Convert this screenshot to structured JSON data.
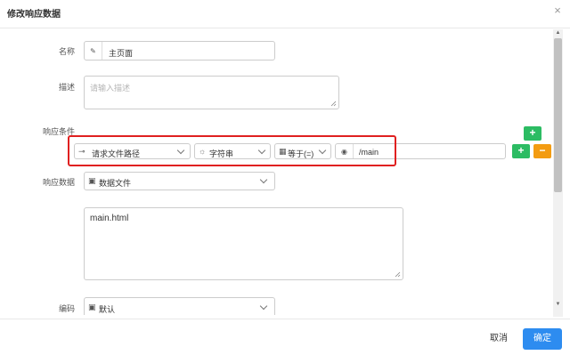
{
  "dialog": {
    "title": "修改响应数据",
    "close_icon": "×"
  },
  "fields": {
    "name": {
      "label": "名称",
      "value": "主页面"
    },
    "desc": {
      "label": "描述",
      "placeholder": "请输入描述"
    },
    "cond": {
      "label": "响应条件",
      "type": "请求文件路径",
      "value_type": "字符串",
      "operator": "等于(=)",
      "value": "/main"
    },
    "resp": {
      "label": "响应数据",
      "type": "数据文件",
      "content": "main.html"
    },
    "encoding": {
      "label": "编码",
      "value": "默认"
    }
  },
  "buttons": {
    "add": "+",
    "remove": "−",
    "cancel": "取消",
    "ok": "确定"
  },
  "scrollbar": {
    "up": "▲",
    "down": "▼"
  },
  "colors": {
    "accent": "#2d8cf0",
    "add": "#2cbc63",
    "remove": "#f39c12",
    "highlight": "#e02020"
  }
}
